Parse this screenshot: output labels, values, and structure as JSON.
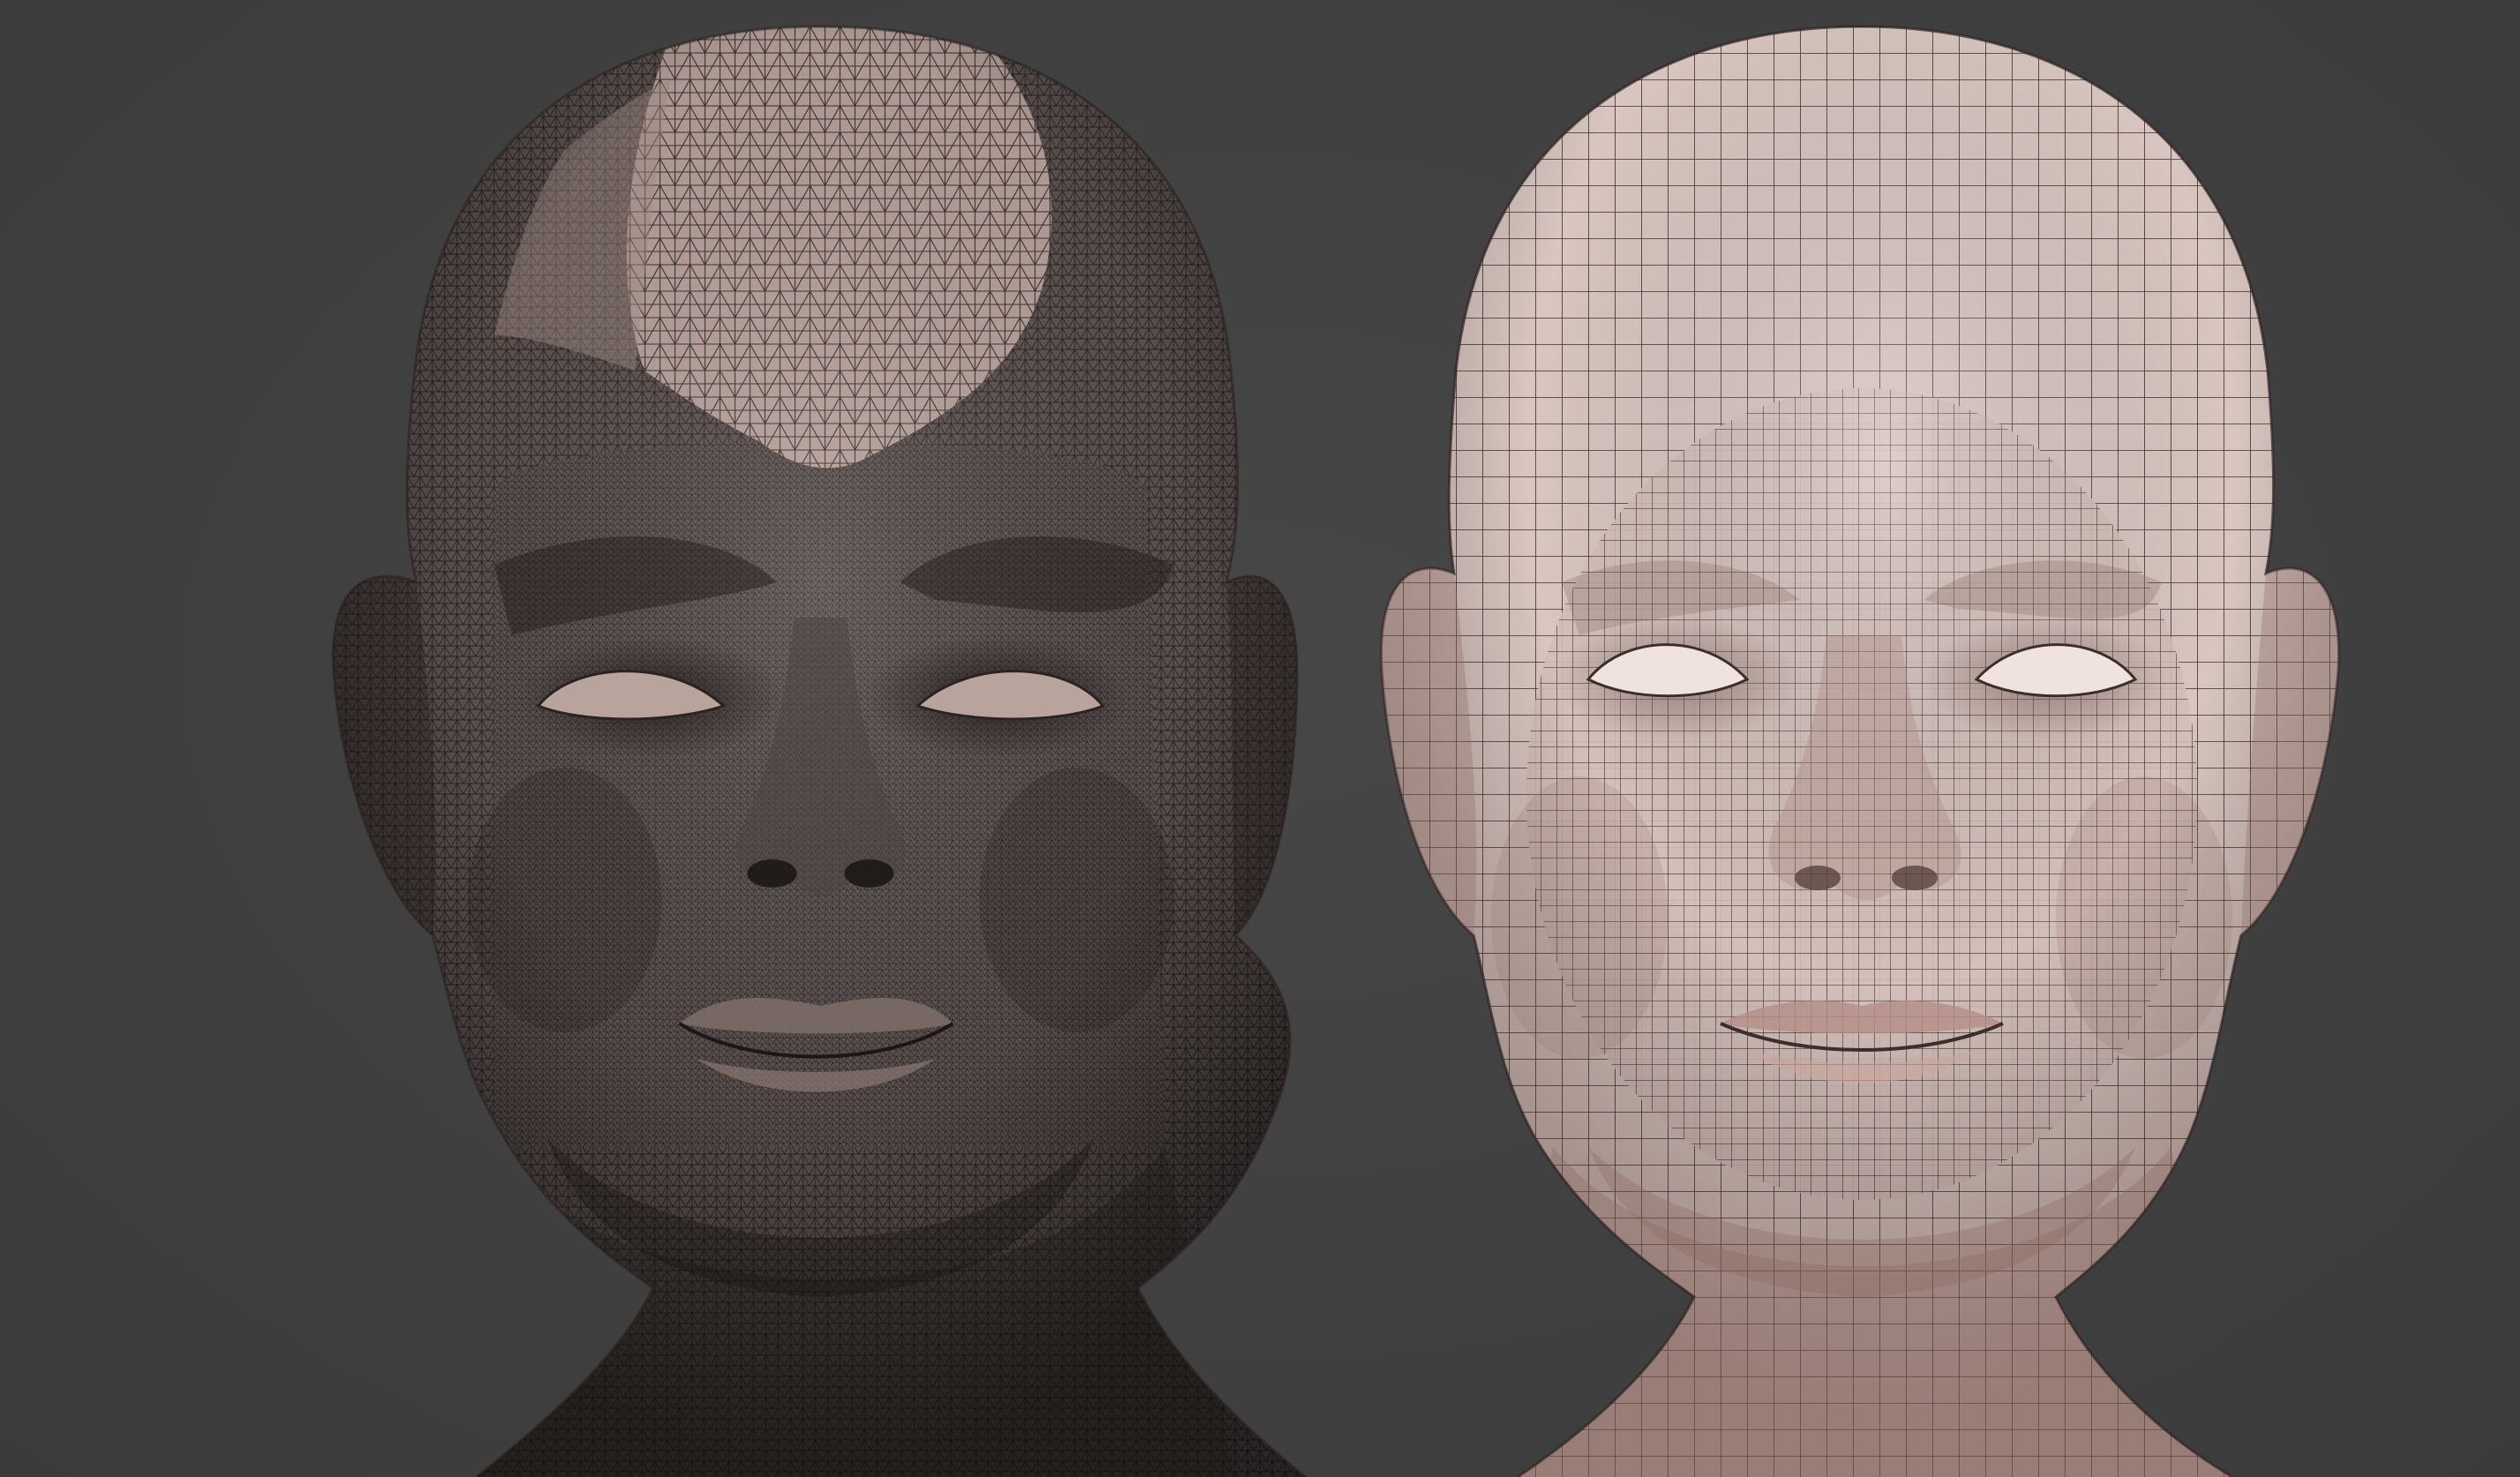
{
  "scene": {
    "background_color": "#404040",
    "left_model": {
      "mesh_type": "triangulated scan mesh",
      "base_color": "#6b5f5c",
      "wire_color": "#2a2424",
      "highlight_color": "#c9b3ac"
    },
    "right_model": {
      "mesh_type": "quad retopology mesh",
      "base_color": "#dcc9c4",
      "wire_color": "#3a2e2c",
      "shadow_color": "#9c7d76"
    }
  }
}
